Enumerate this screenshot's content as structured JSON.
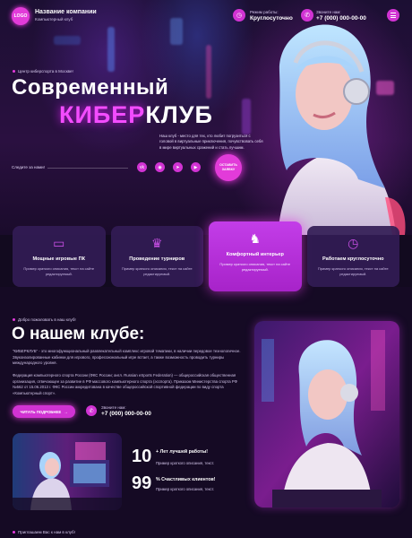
{
  "header": {
    "logo": "LOGO",
    "company_name": "Название компании",
    "company_sub": "Компьютерный клуб",
    "hours_label": "Режим работы:",
    "hours_value": "Круглосуточно",
    "phone_label": "Звоните нам:",
    "phone_value": "+7 (000) 000-00-00"
  },
  "hero": {
    "kicker": "Центр киберспорта в Москве!",
    "title_line1": "Современный",
    "title_hl": "КИБЕР",
    "title_rest": "КЛУБ",
    "desc": "Наш клуб - место для тех, кто любит погрузиться с головой в виртуальные приключения, почувствовать себя в мире виртуальных сражений и стать лучшим.",
    "follow": "Следите за нами!",
    "cta": "ОСТАВИТЬ ЗАЯВКУ"
  },
  "features": [
    {
      "icon": "monitor-icon",
      "title": "Мощные игровые ПК",
      "desc": "Пример краткого описания, текст на сайте редактируемый."
    },
    {
      "icon": "trophy-icon",
      "title": "Проведение турниров",
      "desc": "Пример краткого описания, текст на сайте редактируемый."
    },
    {
      "icon": "gaming-chair-icon",
      "title": "Комфортный интерьер",
      "desc": "Пример краткого описания, текст на сайте редактируемый."
    },
    {
      "icon": "clock-icon",
      "title": "Работаем круглосуточно",
      "desc": "Пример краткого описания, текст на сайте редактируемый."
    }
  ],
  "about": {
    "kicker": "Добро пожаловать в наш клуб!",
    "title": "О нашем клубе:",
    "p1": "\"КИБЕРКЛУБ\" - это многофункциональный развлекательный комплекс игровой тематики, в наличии передовое технологичное. Звукоизолированные кабинки для игрового, профессиональный игре встает, а также возможность проводить турниры международного уровня.",
    "p2": "Федерация компьютерного спорта России (ФКС России; англ. Russian eSports Federation) — общероссийская общественная организация, отвечающее за развитие в РФ массового компьютерного спорта (эсспорта). Приказом Министерства спорта РФ №562 от 15.06.2013 г. ФКС России аккредитована в качестве общероссийской спортивной федерации по виду спорта «Компьютерный спорт».",
    "read_more": "ЧИТАТЬ ПОДРОБНЕЕ",
    "phone_label": "Звоните нам:",
    "phone_value": "+7 (000) 000-00-00"
  },
  "stats": [
    {
      "num": "10",
      "suffix": "+ Лет лучшей работы!",
      "desc": "Пример краткого описания, текст."
    },
    {
      "num": "99",
      "suffix": "% Счастливых клиентов!",
      "desc": "Пример краткого описания, текст."
    }
  ],
  "bottom_kicker": "Приглашаем Вас к нам в клуб!",
  "colors": {
    "accent": "#e23bd9",
    "bg": "#150a24",
    "card": "#321c55"
  }
}
